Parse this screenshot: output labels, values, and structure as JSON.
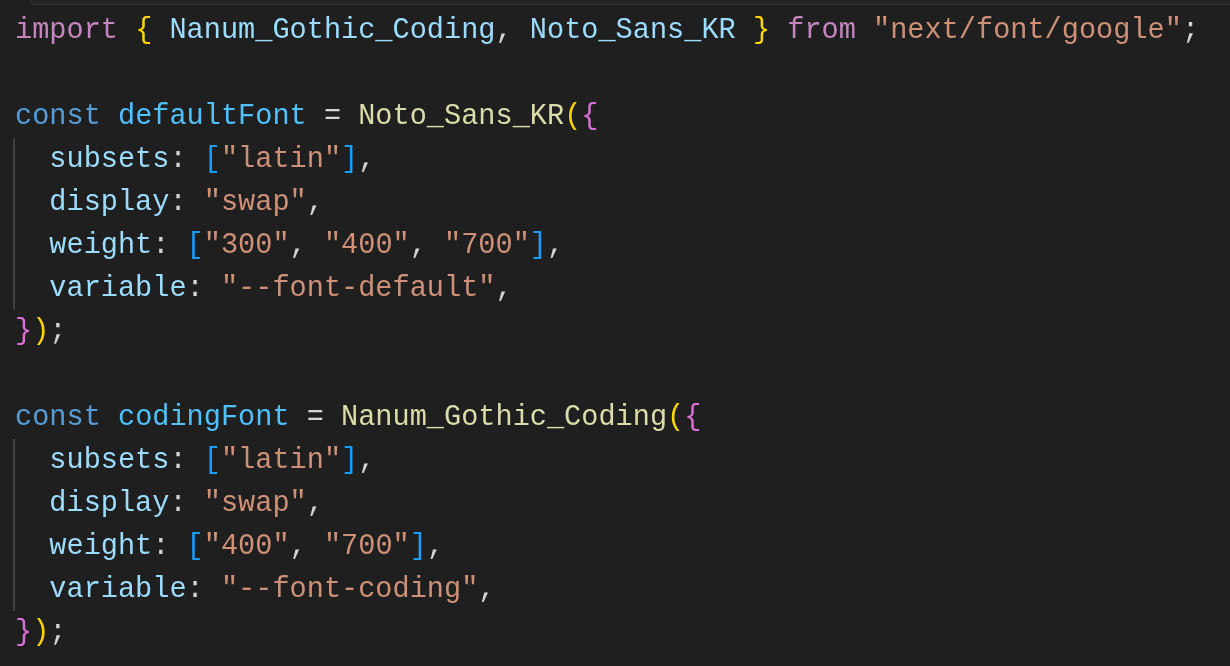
{
  "editor": {
    "lines": [
      {
        "tokens": [
          {
            "text": "import ",
            "kind": "keyword"
          },
          {
            "text": "{",
            "kind": "bracket1"
          },
          {
            "text": " Nanum_Gothic_Coding",
            "kind": "variable"
          },
          {
            "text": ", ",
            "kind": "punct"
          },
          {
            "text": "Noto_Sans_KR ",
            "kind": "variable"
          },
          {
            "text": "}",
            "kind": "bracket1"
          },
          {
            "text": " from ",
            "kind": "keyword"
          },
          {
            "text": "\"next/font/google\"",
            "kind": "string"
          },
          {
            "text": ";",
            "kind": "punct"
          }
        ],
        "indent_guide": false,
        "blank_before": false
      },
      {
        "tokens": [
          {
            "text": "const ",
            "kind": "storage"
          },
          {
            "text": "defaultFont",
            "kind": "constant"
          },
          {
            "text": " = ",
            "kind": "punct"
          },
          {
            "text": "Noto_Sans_KR",
            "kind": "function"
          },
          {
            "text": "(",
            "kind": "bracket1"
          },
          {
            "text": "{",
            "kind": "bracket2"
          }
        ],
        "indent_guide": false,
        "blank_before": true
      },
      {
        "tokens": [
          {
            "text": "  subsets",
            "kind": "variable"
          },
          {
            "text": ": ",
            "kind": "punct"
          },
          {
            "text": "[",
            "kind": "bracket3"
          },
          {
            "text": "\"latin\"",
            "kind": "string"
          },
          {
            "text": "]",
            "kind": "bracket3"
          },
          {
            "text": ",",
            "kind": "punct"
          }
        ],
        "indent_guide": true,
        "blank_before": false
      },
      {
        "tokens": [
          {
            "text": "  display",
            "kind": "variable"
          },
          {
            "text": ": ",
            "kind": "punct"
          },
          {
            "text": "\"swap\"",
            "kind": "string"
          },
          {
            "text": ",",
            "kind": "punct"
          }
        ],
        "indent_guide": true,
        "blank_before": false
      },
      {
        "tokens": [
          {
            "text": "  weight",
            "kind": "variable"
          },
          {
            "text": ": ",
            "kind": "punct"
          },
          {
            "text": "[",
            "kind": "bracket3"
          },
          {
            "text": "\"300\"",
            "kind": "string"
          },
          {
            "text": ", ",
            "kind": "punct"
          },
          {
            "text": "\"400\"",
            "kind": "string"
          },
          {
            "text": ", ",
            "kind": "punct"
          },
          {
            "text": "\"700\"",
            "kind": "string"
          },
          {
            "text": "]",
            "kind": "bracket3"
          },
          {
            "text": ",",
            "kind": "punct"
          }
        ],
        "indent_guide": true,
        "blank_before": false
      },
      {
        "tokens": [
          {
            "text": "  variable",
            "kind": "variable"
          },
          {
            "text": ": ",
            "kind": "punct"
          },
          {
            "text": "\"--font-default\"",
            "kind": "string"
          },
          {
            "text": ",",
            "kind": "punct"
          }
        ],
        "indent_guide": true,
        "blank_before": false
      },
      {
        "tokens": [
          {
            "text": "}",
            "kind": "bracket2"
          },
          {
            "text": ")",
            "kind": "bracket1"
          },
          {
            "text": ";",
            "kind": "punct"
          }
        ],
        "indent_guide": false,
        "blank_before": false
      },
      {
        "tokens": [
          {
            "text": "const ",
            "kind": "storage"
          },
          {
            "text": "codingFont",
            "kind": "constant"
          },
          {
            "text": " = ",
            "kind": "punct"
          },
          {
            "text": "Nanum_Gothic_Coding",
            "kind": "function"
          },
          {
            "text": "(",
            "kind": "bracket1"
          },
          {
            "text": "{",
            "kind": "bracket2"
          }
        ],
        "indent_guide": false,
        "blank_before": true
      },
      {
        "tokens": [
          {
            "text": "  subsets",
            "kind": "variable"
          },
          {
            "text": ": ",
            "kind": "punct"
          },
          {
            "text": "[",
            "kind": "bracket3"
          },
          {
            "text": "\"latin\"",
            "kind": "string"
          },
          {
            "text": "]",
            "kind": "bracket3"
          },
          {
            "text": ",",
            "kind": "punct"
          }
        ],
        "indent_guide": true,
        "blank_before": false
      },
      {
        "tokens": [
          {
            "text": "  display",
            "kind": "variable"
          },
          {
            "text": ": ",
            "kind": "punct"
          },
          {
            "text": "\"swap\"",
            "kind": "string"
          },
          {
            "text": ",",
            "kind": "punct"
          }
        ],
        "indent_guide": true,
        "blank_before": false
      },
      {
        "tokens": [
          {
            "text": "  weight",
            "kind": "variable"
          },
          {
            "text": ": ",
            "kind": "punct"
          },
          {
            "text": "[",
            "kind": "bracket3"
          },
          {
            "text": "\"400\"",
            "kind": "string"
          },
          {
            "text": ", ",
            "kind": "punct"
          },
          {
            "text": "\"700\"",
            "kind": "string"
          },
          {
            "text": "]",
            "kind": "bracket3"
          },
          {
            "text": ",",
            "kind": "punct"
          }
        ],
        "indent_guide": true,
        "blank_before": false
      },
      {
        "tokens": [
          {
            "text": "  variable",
            "kind": "variable"
          },
          {
            "text": ": ",
            "kind": "punct"
          },
          {
            "text": "\"--font-coding\"",
            "kind": "string"
          },
          {
            "text": ",",
            "kind": "punct"
          }
        ],
        "indent_guide": true,
        "blank_before": false
      },
      {
        "tokens": [
          {
            "text": "}",
            "kind": "bracket2"
          },
          {
            "text": ")",
            "kind": "bracket1"
          },
          {
            "text": ";",
            "kind": "punct"
          }
        ],
        "indent_guide": false,
        "blank_before": false
      }
    ]
  }
}
